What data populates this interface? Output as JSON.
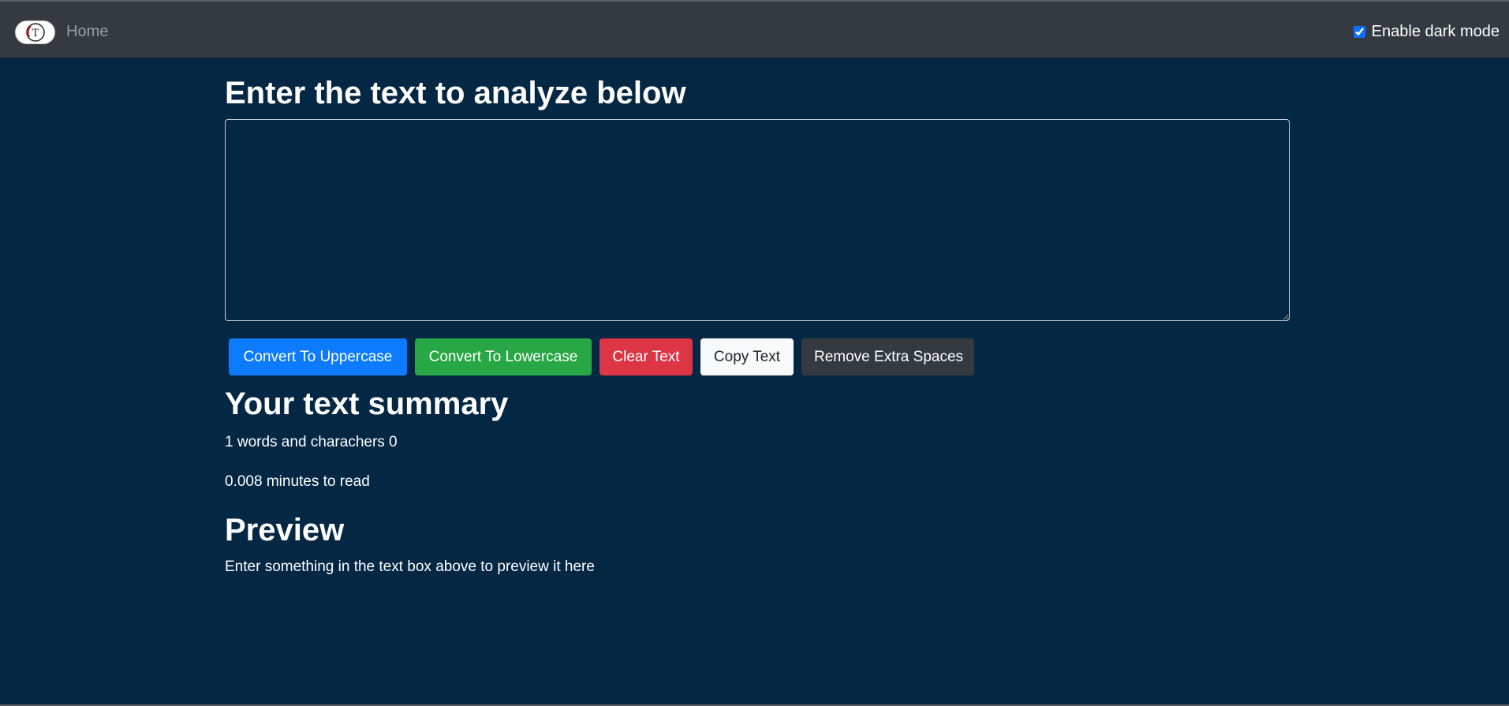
{
  "navbar": {
    "brand_logo_letter": "T",
    "home_label": "Home",
    "dark_mode_label": "Enable dark mode",
    "dark_mode_checked": true
  },
  "main": {
    "heading": "Enter the text to analyze below",
    "textarea_value": "",
    "buttons": {
      "uppercase": "Convert To Uppercase",
      "lowercase": "Convert To Lowercase",
      "clear": "Clear Text",
      "copy": "Copy Text",
      "remove_spaces": "Remove Extra Spaces"
    },
    "summary_heading": "Your text summary",
    "words_line": "1 words and charachers 0",
    "minutes_line": "0.008 minutes to read",
    "preview_heading": "Preview",
    "preview_text": "Enter something in the text box above to preview it here"
  },
  "colors": {
    "background": "#042743",
    "navbar": "#343a40",
    "primary": "#0d7bff",
    "success": "#28a745",
    "danger": "#dc3545",
    "light": "#f8f9fa",
    "dark": "#343a40"
  }
}
